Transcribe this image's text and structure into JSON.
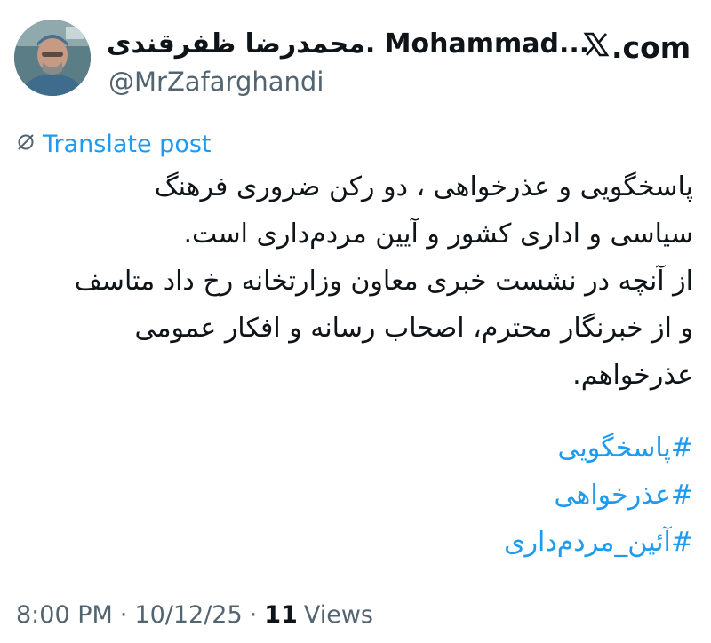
{
  "author": {
    "display_name": "محمدرضا ظفرقندی. Mohammad...",
    "handle": "@MrZafarghandi",
    "avatar_icon": "profile-photo"
  },
  "source": {
    "icon": "x-logo-icon",
    "domain": ".com"
  },
  "translate": {
    "icon": "globe-icon",
    "label": "Translate post"
  },
  "post": {
    "lines": [
      "پاسخگویی و عذرخواهی ، دو رکن ضروری فرهنگ",
      "سیاسی و اداری کشور و آیین مردم‌داری است.",
      "از آنچه در نشست خبری معاون وزارتخانه رخ داد متاسف",
      "و از خبرنگار محترم، اصحاب رسانه و افکار عمومی",
      "عذرخواهم."
    ],
    "hashtags": [
      "#پاسخگویی",
      "#عذرخواهی",
      "#آئین_مردم‌داری"
    ]
  },
  "meta": {
    "time": "8:00 PM",
    "separator": "·",
    "date": "10/12/25",
    "views_count": "11",
    "views_label": "Views"
  },
  "colors": {
    "link": "#1d9bf0",
    "text": "#0f1419",
    "secondary": "#536471"
  }
}
